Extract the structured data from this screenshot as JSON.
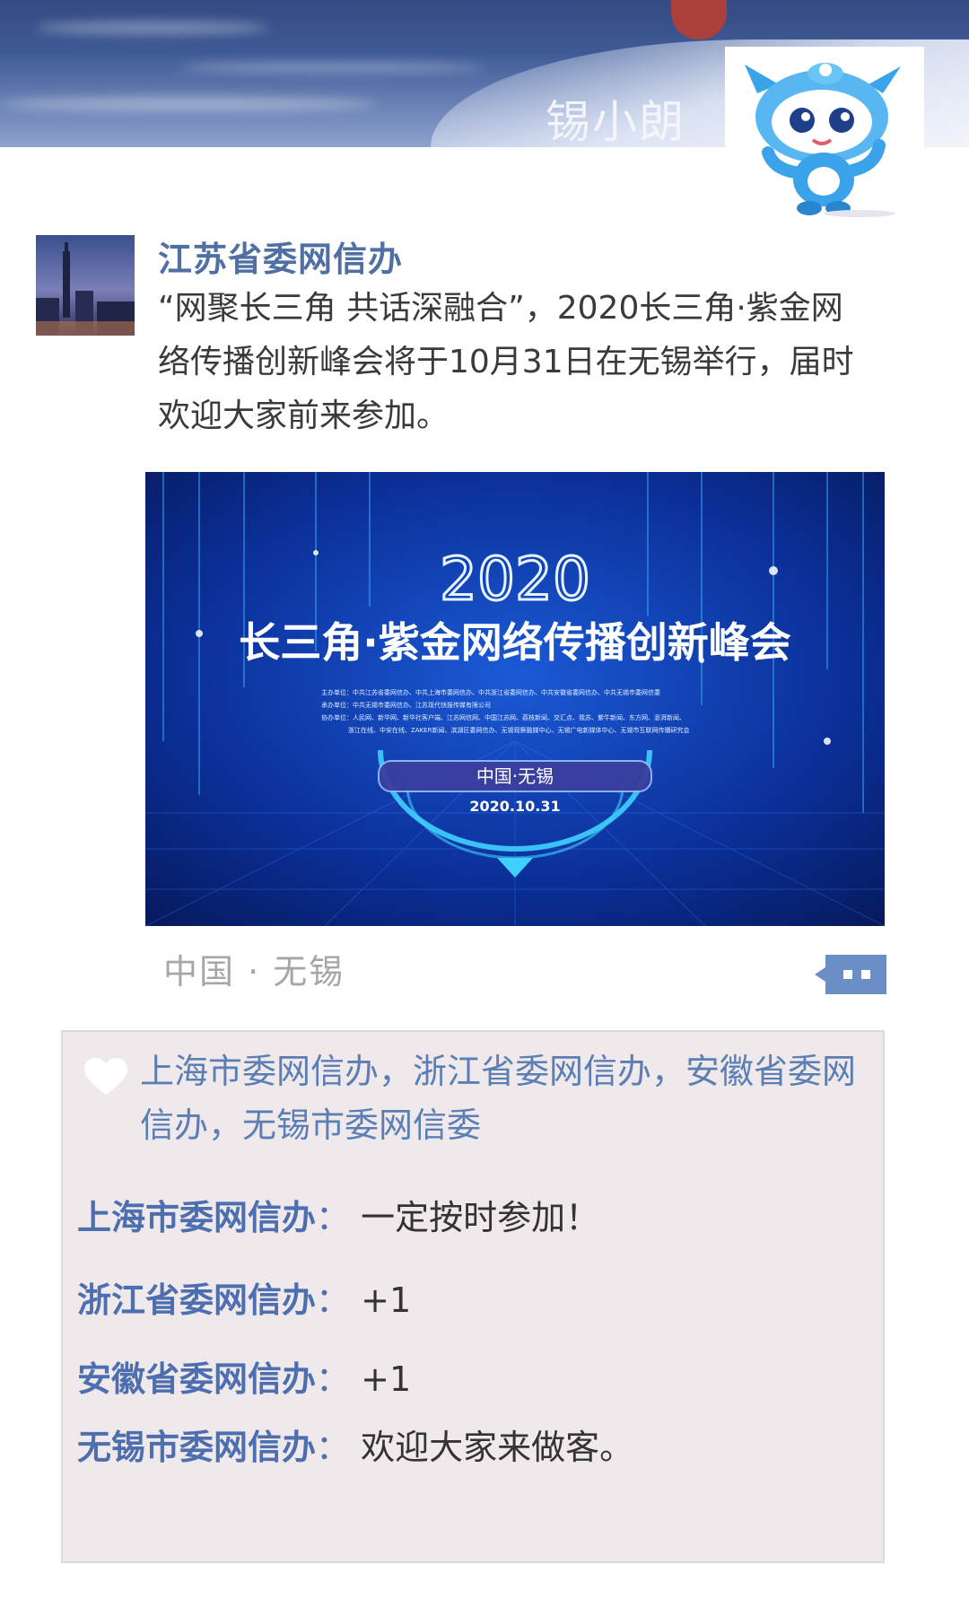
{
  "cover": {
    "title": "锡小朗",
    "mascot_icon": "xixiaolang-mascot-icon"
  },
  "post": {
    "author": "江苏省委网信办",
    "text": "“网聚长三角 共话深融合”，2020长三角·紫金网络传播创新峰会将于10月31日在无锡举行，届时欢迎大家前来参加。",
    "image": {
      "year": "2020",
      "title": "长三角·紫金网络传播创新峰会",
      "organizers": [
        "主办单位：中共江苏省委网信办、中共上海市委网信办、中共浙江省委网信办、中共安徽省委网信办、中共无锡市委网信委",
        "承办单位：中共无锡市委网信办、江苏现代快报传媒有限公司",
        "协办单位：人民网、新华网、新华社客户端、江苏网信网、中国江苏网、荔枝新闻、交汇点、我苏、紫牛新闻、东方网、澎湃新闻、",
        "浙江在线、中安在线、ZAKER新闻、滨湖区委网信办、无锡观察融媒中心、无锡广电新媒体中心、无锡市互联网传播研究会"
      ],
      "place": "中国·无锡",
      "date": "2020.10.31"
    },
    "location": "中国 · 无锡",
    "comment_icon": "comment-bubble-icon"
  },
  "interactions": {
    "like_icon": "heart-icon",
    "likes": "上海市委网信办，浙江省委网信办，安徽省委网信办，无锡市委网信委",
    "comments": [
      {
        "author": "上海市委网信办",
        "sep": "：",
        "text": "一定按时参加！"
      },
      {
        "author": "浙江省委网信办",
        "sep": "：",
        "text": "+1"
      },
      {
        "author": "安徽省委网信办",
        "sep": "：",
        "text": "+1"
      },
      {
        "author": "无锡市委网信办",
        "sep": "：",
        "text": "欢迎大家来做客。"
      }
    ]
  },
  "colors": {
    "author": "#4f6fa5",
    "likes": "#5b7fb5",
    "panel_bg": "#efe9eb",
    "image_bg": "#0a2a8a",
    "accent_cyan": "#3fd0ff"
  }
}
